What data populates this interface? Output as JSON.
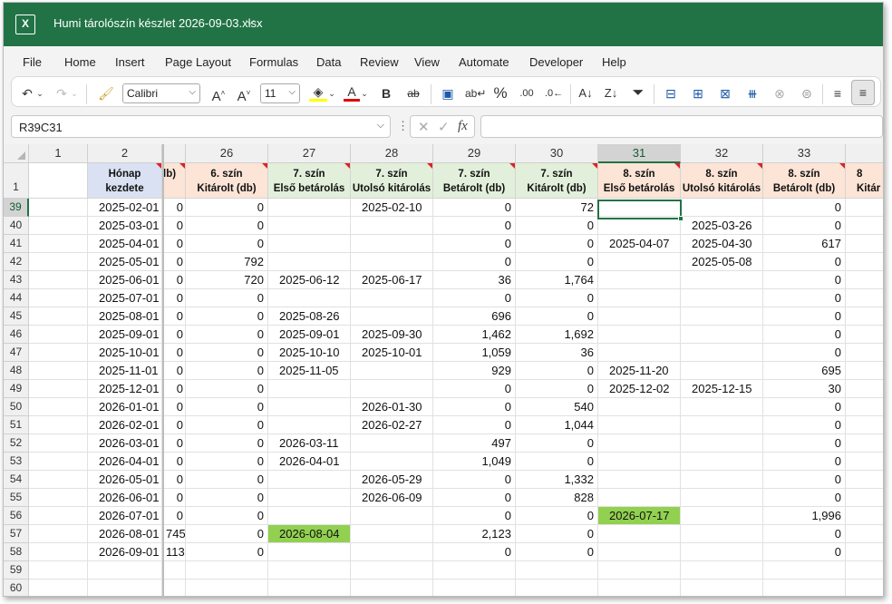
{
  "title": {
    "doc": "Humi tárolószín készlet 2026-09-03.xlsx",
    "chevron": "⌵"
  },
  "menu": [
    "File",
    "Home",
    "Insert",
    "Page Layout",
    "Formulas",
    "Data",
    "Review",
    "View",
    "Automate",
    "Developer",
    "Help"
  ],
  "toolbar": {
    "font": "Calibri",
    "size": "11"
  },
  "namebox": "R39C31",
  "fx": {
    "label": "fx",
    "cancel": "✕",
    "enter": "✓",
    "dots": "⋮"
  },
  "columns": [
    {
      "label": "1"
    },
    {
      "label": "2"
    },
    {
      "label": ""
    },
    {
      "label": "26"
    },
    {
      "label": "27"
    },
    {
      "label": "28"
    },
    {
      "label": "29"
    },
    {
      "label": "30"
    },
    {
      "label": "31"
    },
    {
      "label": "32"
    },
    {
      "label": "33"
    },
    {
      "label": ""
    }
  ],
  "header_row": {
    "num": "1",
    "cells": [
      {
        "l1": "",
        "l2": "",
        "bg": "#ffffff"
      },
      {
        "l1": "Hónap",
        "l2": "kezdete",
        "bg": "#d9e1f2",
        "tri": true
      },
      {
        "l1": "",
        "l2": "lb)",
        "bg": "#fce4d6",
        "tri": true
      },
      {
        "l1": "6. szín",
        "l2": "Kitárolt (db)",
        "bg": "#fce4d6",
        "tri": true
      },
      {
        "l1": "7. szín",
        "l2": "Első betárolás",
        "bg": "#e2efda",
        "tri": true
      },
      {
        "l1": "7. szín",
        "l2": "Utolsó kitárolás",
        "bg": "#e2efda",
        "tri": true
      },
      {
        "l1": "7. szín",
        "l2": "Betárolt (db)",
        "bg": "#e2efda",
        "tri": true
      },
      {
        "l1": "7. szín",
        "l2": "Kitárolt (db)",
        "bg": "#e2efda",
        "tri": true
      },
      {
        "l1": "8. szín",
        "l2": "Első betárolás",
        "bg": "#fce4d6",
        "tri": true
      },
      {
        "l1": "8. szín",
        "l2": "Utolsó kitárolás",
        "bg": "#fce4d6",
        "tri": true
      },
      {
        "l1": "8. szín",
        "l2": "Betárolt (db)",
        "bg": "#fce4d6",
        "tri": true
      },
      {
        "l1": "8",
        "l2": "Kitár",
        "bg": "#fce4d6",
        "tri": false
      }
    ]
  },
  "rows": [
    {
      "num": "39",
      "cells": [
        "",
        "2025-02-01",
        "0",
        "0",
        "",
        "2025-02-10",
        "0",
        "72",
        "",
        "",
        "0",
        ""
      ]
    },
    {
      "num": "40",
      "cells": [
        "",
        "2025-03-01",
        "0",
        "0",
        "",
        "",
        "0",
        "0",
        "",
        "2025-03-26",
        "0",
        ""
      ]
    },
    {
      "num": "41",
      "cells": [
        "",
        "2025-04-01",
        "0",
        "0",
        "",
        "",
        "0",
        "0",
        "2025-04-07",
        "2025-04-30",
        "617",
        ""
      ]
    },
    {
      "num": "42",
      "cells": [
        "",
        "2025-05-01",
        "0",
        "792",
        "",
        "",
        "0",
        "0",
        "",
        "2025-05-08",
        "0",
        ""
      ]
    },
    {
      "num": "43",
      "cells": [
        "",
        "2025-06-01",
        "0",
        "720",
        "2025-06-12",
        "2025-06-17",
        "36",
        "1,764",
        "",
        "",
        "0",
        ""
      ]
    },
    {
      "num": "44",
      "cells": [
        "",
        "2025-07-01",
        "0",
        "0",
        "",
        "",
        "0",
        "0",
        "",
        "",
        "0",
        ""
      ]
    },
    {
      "num": "45",
      "cells": [
        "",
        "2025-08-01",
        "0",
        "0",
        "2025-08-26",
        "",
        "696",
        "0",
        "",
        "",
        "0",
        ""
      ]
    },
    {
      "num": "46",
      "cells": [
        "",
        "2025-09-01",
        "0",
        "0",
        "2025-09-01",
        "2025-09-30",
        "1,462",
        "1,692",
        "",
        "",
        "0",
        ""
      ]
    },
    {
      "num": "47",
      "cells": [
        "",
        "2025-10-01",
        "0",
        "0",
        "2025-10-10",
        "2025-10-01",
        "1,059",
        "36",
        "",
        "",
        "0",
        ""
      ]
    },
    {
      "num": "48",
      "cells": [
        "",
        "2025-11-01",
        "0",
        "0",
        "2025-11-05",
        "",
        "929",
        "0",
        "2025-11-20",
        "",
        "695",
        ""
      ]
    },
    {
      "num": "49",
      "cells": [
        "",
        "2025-12-01",
        "0",
        "0",
        "",
        "",
        "0",
        "0",
        "2025-12-02",
        "2025-12-15",
        "30",
        ""
      ]
    },
    {
      "num": "50",
      "cells": [
        "",
        "2026-01-01",
        "0",
        "0",
        "",
        "2026-01-30",
        "0",
        "540",
        "",
        "",
        "0",
        ""
      ]
    },
    {
      "num": "51",
      "cells": [
        "",
        "2026-02-01",
        "0",
        "0",
        "",
        "2026-02-27",
        "0",
        "1,044",
        "",
        "",
        "0",
        ""
      ]
    },
    {
      "num": "52",
      "cells": [
        "",
        "2026-03-01",
        "0",
        "0",
        "2026-03-11",
        "",
        "497",
        "0",
        "",
        "",
        "0",
        ""
      ]
    },
    {
      "num": "53",
      "cells": [
        "",
        "2026-04-01",
        "0",
        "0",
        "2026-04-01",
        "",
        "1,049",
        "0",
        "",
        "",
        "0",
        ""
      ]
    },
    {
      "num": "54",
      "cells": [
        "",
        "2026-05-01",
        "0",
        "0",
        "",
        "2026-05-29",
        "0",
        "1,332",
        "",
        "",
        "0",
        ""
      ]
    },
    {
      "num": "55",
      "cells": [
        "",
        "2026-06-01",
        "0",
        "0",
        "",
        "2026-06-09",
        "0",
        "828",
        "",
        "",
        "0",
        ""
      ]
    },
    {
      "num": "56",
      "cells": [
        "",
        "2026-07-01",
        "0",
        "0",
        "",
        "",
        "0",
        "0",
        "2026-07-17",
        "",
        "1,996",
        ""
      ]
    },
    {
      "num": "57",
      "cells": [
        "",
        "2026-08-01",
        "745",
        "0",
        "2026-08-04",
        "",
        "2,123",
        "0",
        "",
        "",
        "0",
        ""
      ]
    },
    {
      "num": "58",
      "cells": [
        "",
        "2026-09-01",
        "113",
        "0",
        "",
        "",
        "0",
        "0",
        "",
        "",
        "0",
        ""
      ]
    },
    {
      "num": "59",
      "cells": [
        "",
        "",
        "",
        "",
        "",
        "",
        "",
        "",
        "",
        "",
        "",
        ""
      ]
    },
    {
      "num": "60",
      "cells": [
        "",
        "",
        "",
        "",
        "",
        "",
        "",
        "",
        "",
        "",
        "",
        ""
      ]
    }
  ],
  "highlights": [
    {
      "row": "56",
      "col": 8,
      "color": "#92d050"
    },
    {
      "row": "57",
      "col": 4,
      "color": "#92d050"
    }
  ],
  "selected": {
    "row": "39",
    "col": 8
  },
  "colors": {
    "brand": "#217346",
    "highlight": "#92d050"
  }
}
